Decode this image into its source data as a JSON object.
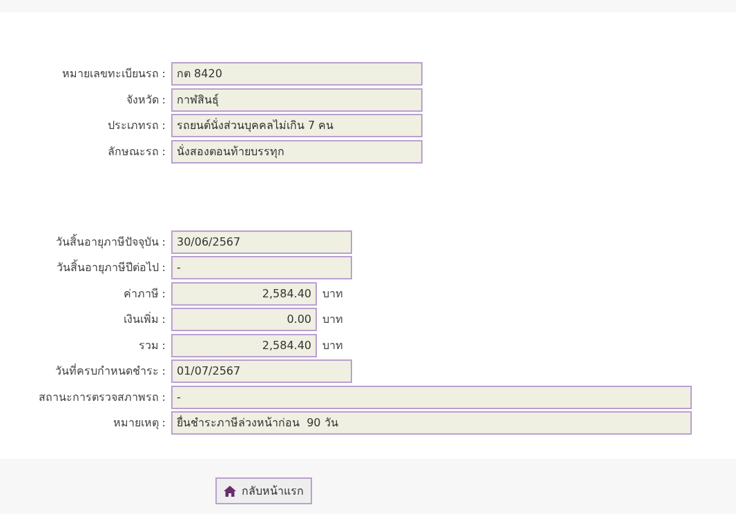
{
  "vehicle": [
    {
      "label": "หมายเลขทะเบียนรถ :",
      "value": "กต 8420",
      "kind": "medium"
    },
    {
      "label": "จังหวัด :",
      "value": "กาฬสินธุ์",
      "kind": "medium"
    },
    {
      "label": "ประเภทรถ :",
      "value": "รถยนต์นั่งส่วนบุคคลไม่เกิน 7 คน",
      "kind": "medium"
    },
    {
      "label": "ลักษณะรถ :",
      "value": "นั่งสองตอนท้ายบรรทุก",
      "kind": "medium"
    }
  ],
  "tax": [
    {
      "label": "วันสิ้นอายุภาษีปัจจุบัน :",
      "value": "30/06/2567",
      "kind": "short"
    },
    {
      "label": "วันสิ้นอายุภาษีปีต่อไป :",
      "value": "-",
      "kind": "short"
    },
    {
      "label": "ค่าภาษี :",
      "value": "2,584.40",
      "unit": "บาท",
      "kind": "money"
    },
    {
      "label": "เงินเพิ่ม :",
      "value": "0.00",
      "unit": "บาท",
      "kind": "money"
    },
    {
      "label": "รวม :",
      "value": "2,584.40",
      "unit": "บาท",
      "kind": "money"
    },
    {
      "label": "วันที่ครบกำหนดชำระ :",
      "value": "01/07/2567",
      "kind": "short"
    },
    {
      "label": "สถานะการตรวจสภาพรถ :",
      "value": "-",
      "kind": "wide"
    },
    {
      "label": "หมายเหตุ :",
      "value": "ยื่นชำระภาษีล่วงหน้าก่อน  90 วัน",
      "kind": "wide"
    }
  ],
  "home_button": {
    "label": "กลับหน้าแรก"
  }
}
